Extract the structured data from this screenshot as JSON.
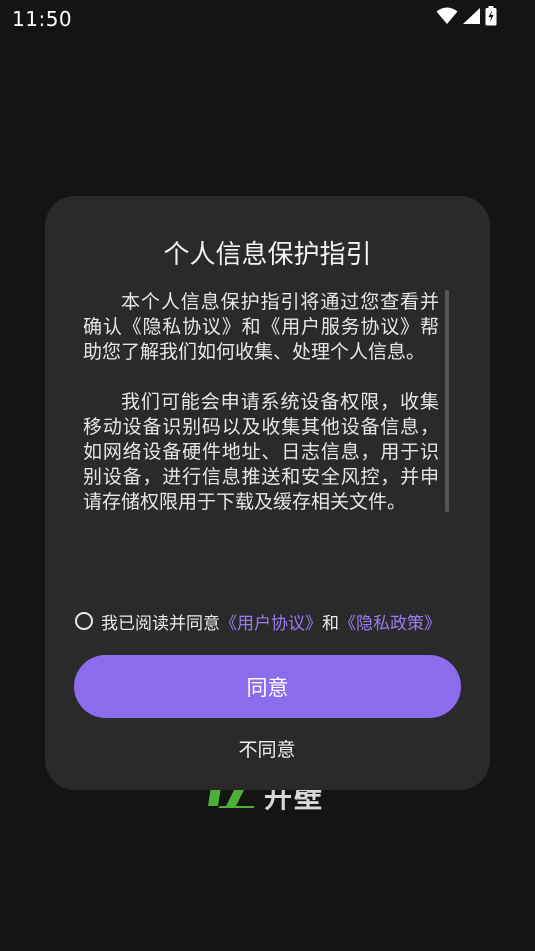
{
  "status_bar": {
    "time": "11:50",
    "icons": [
      "wifi-icon",
      "cellular-signal-icon",
      "battery-charging-icon"
    ]
  },
  "background": {
    "logo_text": "开壁"
  },
  "dialog": {
    "title": "个人信息保护指引",
    "paragraphs": [
      "本个人信息保护指引将通过您查看并确认《隐私协议》和《用户服务协议》帮助您了解我们如何收集、处理个人信息。",
      "我们可能会申请系统设备权限，收集移动设备识别码以及收集其他设备信息，如网络设备硬件地址、日志信息，用于识别设备，进行信息推送和安全风控，并申请存储权限用于下载及缓存相关文件。"
    ],
    "agreement": {
      "prefix": "我已阅读并同意",
      "user_agreement_link": "《用户协议》",
      "connector": "和",
      "privacy_policy_link": "《隐私政策》",
      "checked": false
    },
    "agree_label": "同意",
    "disagree_label": "不同意"
  },
  "colors": {
    "accent": "#8a6cec",
    "link": "#9a7cf0",
    "dialog_bg": "#2a2a2b",
    "screen_bg": "#141414",
    "logo_green": "#4caf3a"
  }
}
